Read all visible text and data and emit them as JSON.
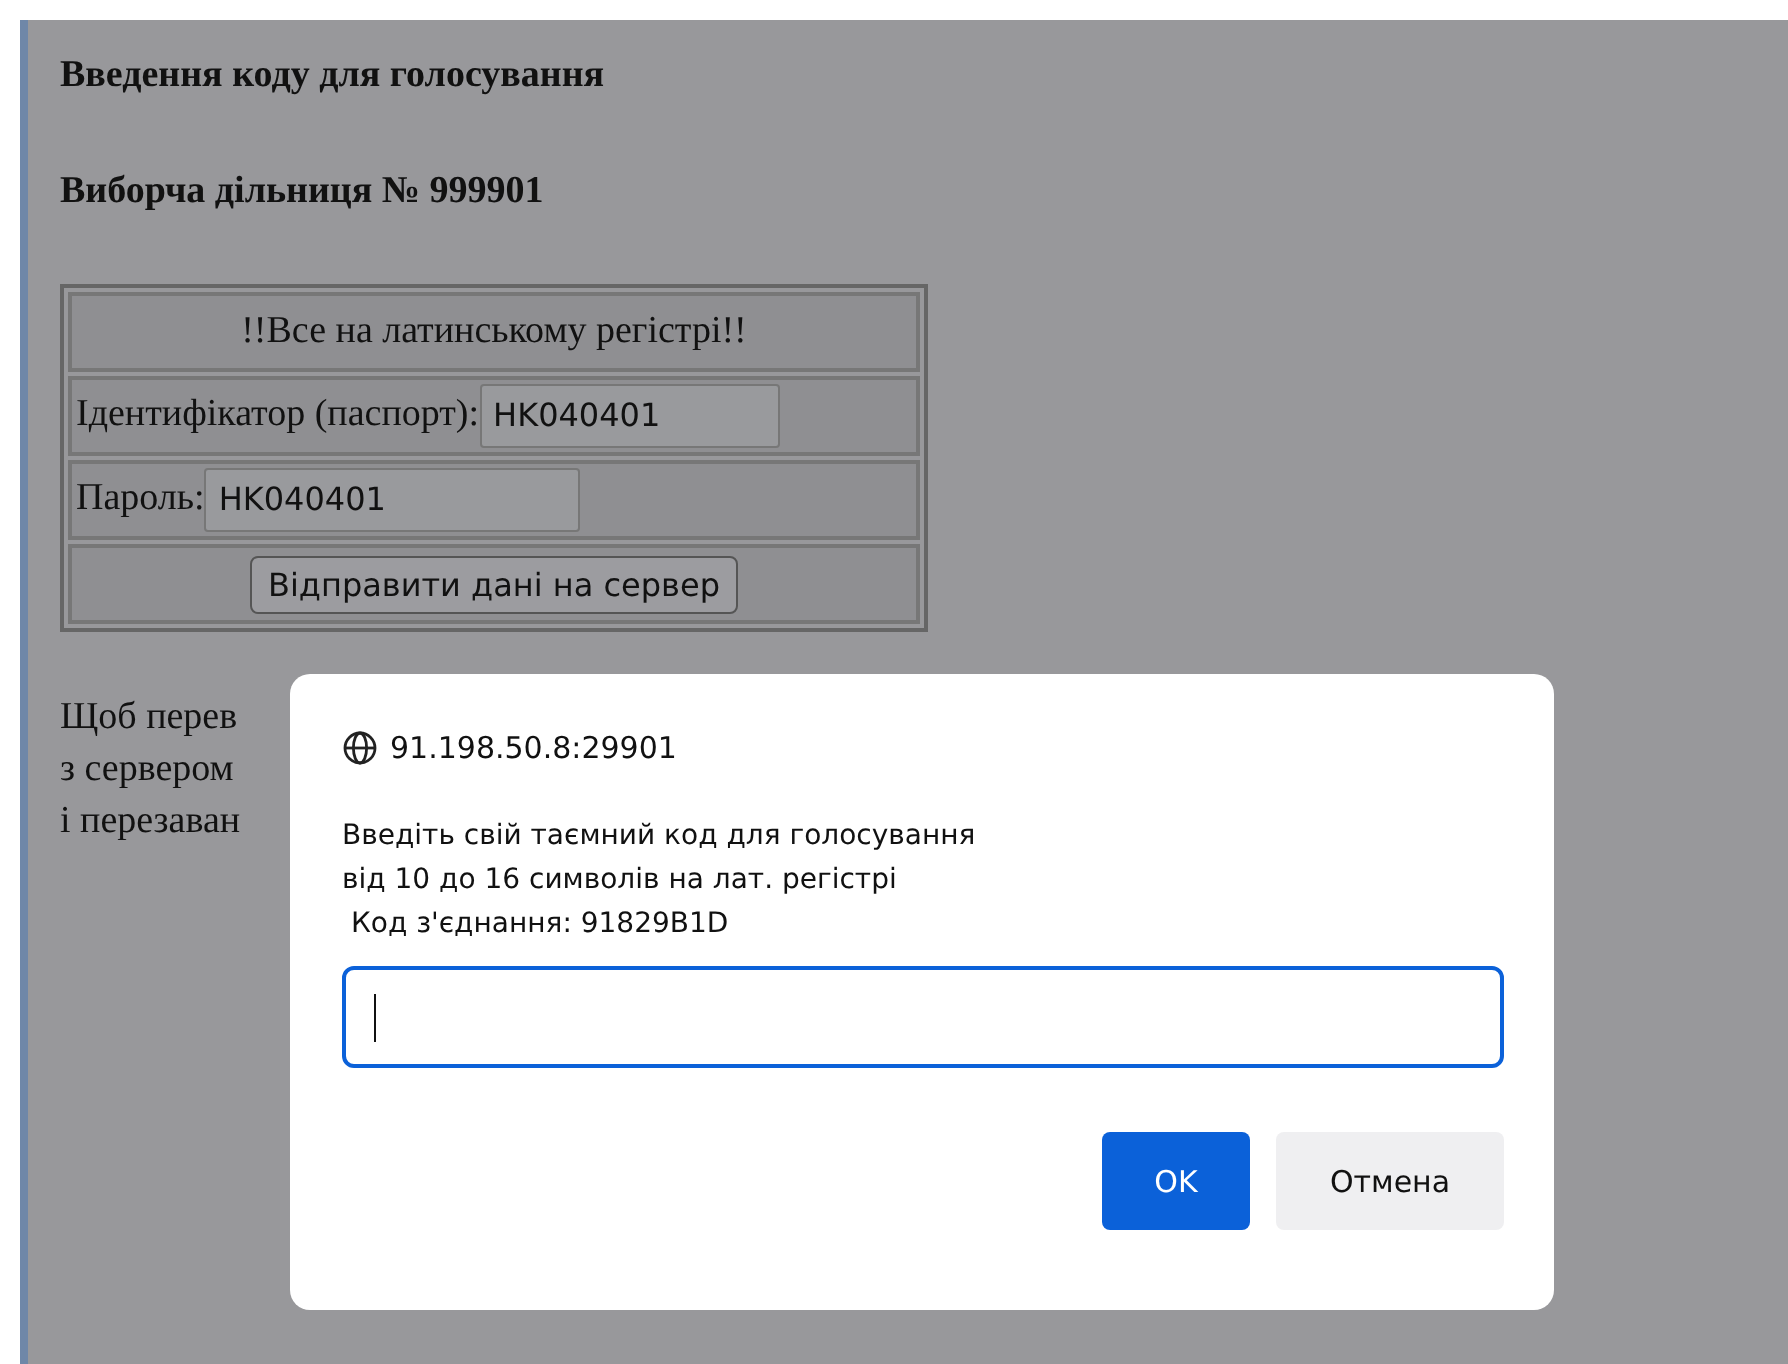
{
  "page": {
    "title": "Введення коду для голосування",
    "subtitle": "Виборча дільниця № 999901"
  },
  "form": {
    "notice": "!!Все на латинському регістрі!!",
    "fields": [
      {
        "label": "Ідентифікатор (паспорт):",
        "value": "HK040401",
        "kind": "wide"
      },
      {
        "label": "Пароль:",
        "value": "HK040401",
        "kind": "narrow"
      }
    ],
    "submit": "Відправити дані на сервер"
  },
  "note_lines": [
    "Щоб перев",
    "з сервером",
    "і перезаван"
  ],
  "dialog": {
    "origin": "91.198.50.8:29901",
    "message_lines": [
      "Введіть свій таємний код для голосування",
      "від 10 до 16 символів на лат. регістрі",
      " Код з'єднання: 91829B1D"
    ],
    "ok": "OK",
    "cancel": "Отмена"
  }
}
